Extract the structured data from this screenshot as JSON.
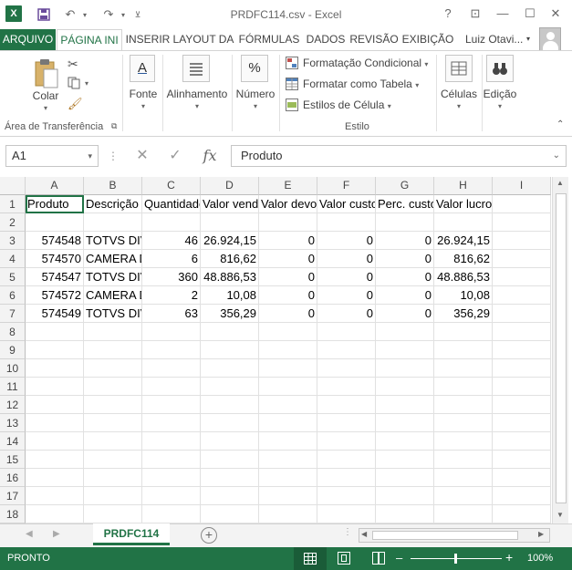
{
  "title": "PRDFC114.csv - Excel",
  "qat": {
    "app_icon": "X",
    "save_icon": "save-icon",
    "undo_icon": "undo-icon",
    "redo_icon": "redo-icon"
  },
  "window": {
    "help": "?",
    "restore_ribbon": "⊡",
    "minimize": "—",
    "maximize": "☐",
    "close": "✕"
  },
  "tabs": [
    "ARQUIVO",
    "PÁGINA INI",
    "INSERIR",
    "LAYOUT DA",
    "FÓRMULAS",
    "DADOS",
    "REVISÃO",
    "EXIBIÇÃO"
  ],
  "user": "Luiz Otavi...",
  "ribbon": {
    "paste_label": "Colar",
    "clipboard_label": "Área de Transferência",
    "font_label": "Fonte",
    "alignment_label": "Alinhamento",
    "number_label": "Número",
    "percent_symbol": "%",
    "font_letter": "A",
    "style_items": [
      "Formatação Condicional",
      "Formatar como Tabela",
      "Estilos de Célula"
    ],
    "style_label": "Estilo",
    "cells_label": "Células",
    "editing_label": "Edição"
  },
  "formula_bar": {
    "name_box": "A1",
    "fx": "fx",
    "content": "Produto"
  },
  "columns": [
    "A",
    "B",
    "C",
    "D",
    "E",
    "F",
    "G",
    "H",
    "I"
  ],
  "rows": [
    [
      "Produto",
      "Descrição",
      "Quantidade",
      "Valor vendido",
      "Valor devolvido",
      "Valor custo",
      "Perc. custo",
      "Valor lucro",
      ""
    ],
    [
      "",
      "",
      "",
      "",
      "",
      "",
      "",
      "",
      ""
    ],
    [
      "574548",
      "TOTVS DIVERSOS",
      "46",
      "26.924,15",
      "0",
      "0",
      "0",
      "26.924,15",
      ""
    ],
    [
      "574570",
      "CAMERA DIGITAL",
      "6",
      "816,62",
      "0",
      "0",
      "0",
      "816,62",
      ""
    ],
    [
      "574547",
      "TOTVS DIVERSOS",
      "360",
      "48.886,53",
      "0",
      "0",
      "0",
      "48.886,53",
      ""
    ],
    [
      "574572",
      "CAMERA DIGITAL",
      "2",
      "10,08",
      "0",
      "0",
      "0",
      "10,08",
      ""
    ],
    [
      "574549",
      "TOTVS DIVERSOS",
      "63",
      "356,29",
      "0",
      "0",
      "0",
      "356,29",
      ""
    ],
    [
      "",
      "",
      "",
      "",
      "",
      "",
      "",
      "",
      ""
    ],
    [
      "",
      "",
      "",
      "",
      "",
      "",
      "",
      "",
      ""
    ],
    [
      "",
      "",
      "",
      "",
      "",
      "",
      "",
      "",
      ""
    ],
    [
      "",
      "",
      "",
      "",
      "",
      "",
      "",
      "",
      ""
    ],
    [
      "",
      "",
      "",
      "",
      "",
      "",
      "",
      "",
      ""
    ],
    [
      "",
      "",
      "",
      "",
      "",
      "",
      "",
      "",
      ""
    ],
    [
      "",
      "",
      "",
      "",
      "",
      "",
      "",
      "",
      ""
    ],
    [
      "",
      "",
      "",
      "",
      "",
      "",
      "",
      "",
      ""
    ],
    [
      "",
      "",
      "",
      "",
      "",
      "",
      "",
      "",
      ""
    ],
    [
      "",
      "",
      "",
      "",
      "",
      "",
      "",
      "",
      ""
    ],
    [
      "",
      "",
      "",
      "",
      "",
      "",
      "",
      "",
      ""
    ]
  ],
  "numeric_columns": [
    0,
    2,
    3,
    4,
    5,
    6,
    7
  ],
  "sheet_tab": "PRDFC114",
  "status": {
    "ready": "PRONTO",
    "zoom": "100%"
  },
  "colors": {
    "accent": "#217346"
  }
}
